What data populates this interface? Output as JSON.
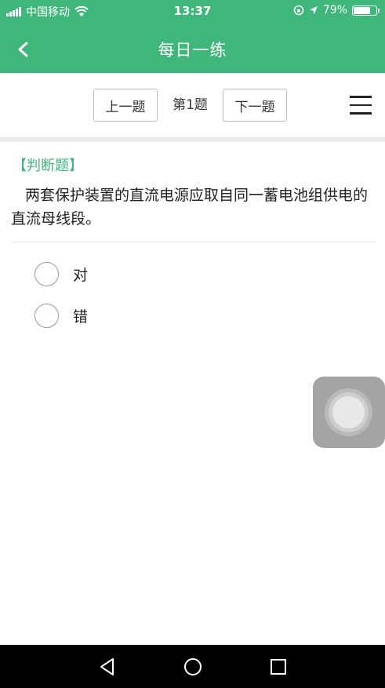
{
  "status_bar": {
    "carrier": "中国移动",
    "time": "13:37",
    "battery": "79%",
    "battery_level": 0.79
  },
  "header": {
    "title": "每日一练",
    "back_icon": "chevron-left-icon"
  },
  "question_nav": {
    "prev_label": "上一题",
    "page_label": "第1题",
    "next_label": "下一题",
    "menu_icon": "hamburger-menu-icon"
  },
  "question": {
    "type_label": "【判断题】",
    "text": "两套保护装置的直流电源应取自同一蓄电池组供电的直流母线段。",
    "options": [
      {
        "label": "对",
        "selected": false
      },
      {
        "label": "错",
        "selected": false
      }
    ]
  },
  "system_nav": {
    "icons": [
      "back-triangle-icon",
      "home-circle-icon",
      "recents-square-icon"
    ]
  },
  "colors": {
    "accent": "#3fb67a",
    "system_bar": "#000000"
  }
}
